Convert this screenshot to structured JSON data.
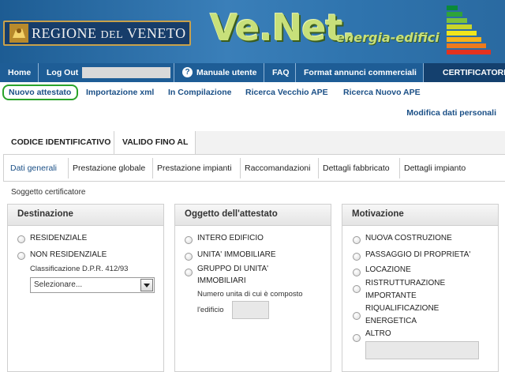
{
  "header": {
    "logo_text_1": "REGIONE",
    "logo_text_2": "DEL",
    "logo_text_3": "VENETO",
    "product_name": "Ve.Net.",
    "product_sub": "energia-edifici"
  },
  "nav": {
    "home": "Home",
    "logout": "Log Out",
    "manual": "Manuale utente",
    "help_glyph": "?",
    "faq": "FAQ",
    "format": "Format annunci commerciali",
    "certificatore": "CERTIFICATORE"
  },
  "subnav": {
    "items": [
      "Nuovo attestato",
      "Importazione xml",
      "In Compilazione",
      "Ricerca Vecchio APE",
      "Ricerca Nuovo APE"
    ]
  },
  "modifica": "Modifica dati personali",
  "table_head": {
    "col1": "CODICE IDENTIFICATIVO",
    "col2": "VALIDO FINO AL"
  },
  "section_tabs": [
    "Dati generali",
    "Prestazione globale",
    "Prestazione impianti",
    "Raccomandazioni",
    "Dettagli fabbricato",
    "Dettagli impianto"
  ],
  "soggetto": "Soggetto certificatore",
  "destinazione": {
    "title": "Destinazione",
    "opt1": "RESIDENZIALE",
    "opt2": "NON RESIDENZIALE",
    "classification_label": "Classificazione D.P.R. 412/93",
    "select_value": "Selezionare..."
  },
  "oggetto": {
    "title": "Oggetto dell'attestato",
    "opt1": "INTERO EDIFICIO",
    "opt2": "UNITA' IMMOBILIARE",
    "opt3a": "GRUPPO DI UNITA'",
    "opt3b": "IMMOBILIARI",
    "note1": "Numero unita di cui è composto",
    "note2": "l'edificio"
  },
  "motivazione": {
    "title": "Motivazione",
    "opt1": "NUOVA COSTRUZIONE",
    "opt2": "PASSAGGIO DI PROPRIETA'",
    "opt3": "LOCAZIONE",
    "opt4a": "RISTRUTTURAZIONE",
    "opt4b": "IMPORTANTE",
    "opt5a": "RIQUALIFICAZIONE",
    "opt5b": "ENERGETICA",
    "opt6": "ALTRO"
  },
  "colors": {
    "nav_blue": "#1e5d96",
    "link_blue": "#1a4f86",
    "active_outline": "#2aa32a"
  },
  "icons": [
    "lion-emblem-icon",
    "energy-rating-icon",
    "help-icon",
    "dropdown-arrow-icon"
  ]
}
